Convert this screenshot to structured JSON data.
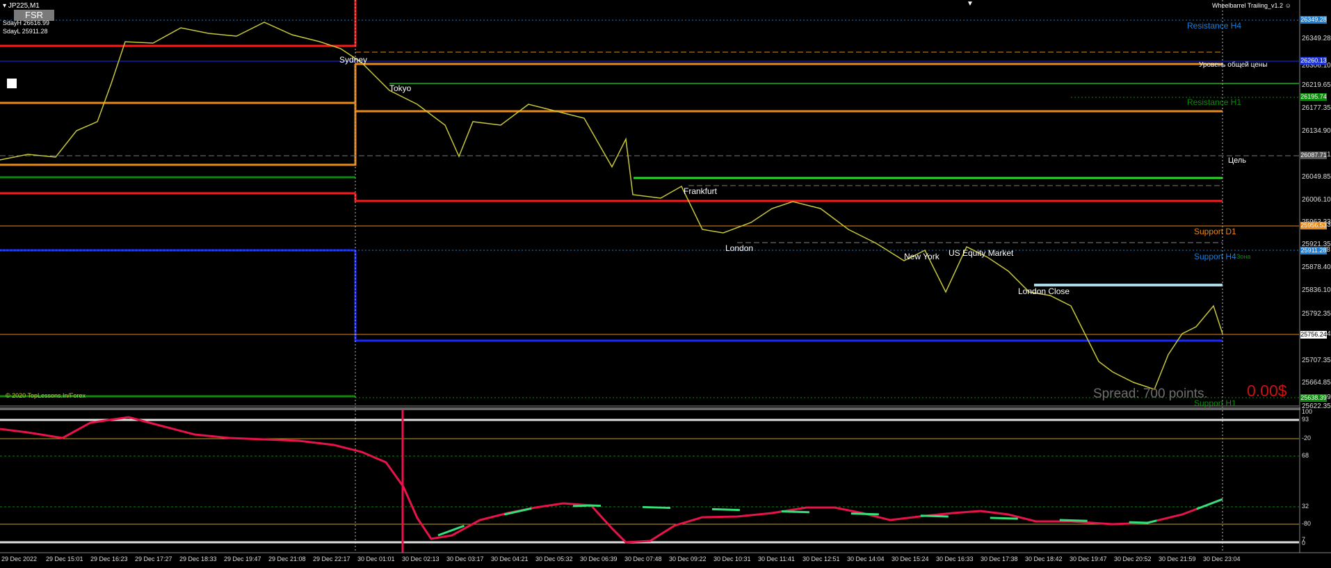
{
  "header": {
    "symbol": "JP225,M1",
    "sdayh": "SdayH 26616.99",
    "sdayl": "SdayL 25911.28",
    "fsr_button": "FSR",
    "expert_name": "Wheelbarrel Trailing_v1.2",
    "copyright": "© 2020 TopLessons.In/Forex"
  },
  "sessions": [
    "Sydney",
    "Tokyo",
    "Frankfurt",
    "London",
    "New York",
    "US Equity Market",
    "London Close"
  ],
  "level_labels": {
    "resistance_h4": "Resistance H4",
    "price_level_ru": "Уровень общей цены",
    "resistance_h1": "Resistance H1",
    "target_ru": "Цель",
    "support_d1": "Support D1",
    "support_h4": "Support H4",
    "support_h1": "Support H1",
    "zone_ru": "Зона"
  },
  "spread": "Spread: 700 points.",
  "profit": "0.00$",
  "price_axis": [
    "26349.28",
    "26306.10",
    "26219.65",
    "26177.35",
    "26134.90",
    "26087.71",
    "26049.85",
    "26006.10",
    "25963.33",
    "25956.53",
    "25921.35",
    "25911.28",
    "25878.40",
    "25836.10",
    "25792.35",
    "25756.24",
    "25707.35",
    "25664.85",
    "25638.39",
    "25622.35"
  ],
  "price_tags": [
    {
      "text": "26349.28",
      "color": "#1e7fd6"
    },
    {
      "text": "26260.13",
      "color": "#1e35d6"
    },
    {
      "text": "26195.74",
      "color": "#0c8a0c"
    },
    {
      "text": "26087.71",
      "color": "#555555"
    },
    {
      "text": "25956.53",
      "color": "#e8891a"
    },
    {
      "text": "25911.28",
      "color": "#1e7fd6"
    },
    {
      "text": "25756.24",
      "color": "#ffffff"
    },
    {
      "text": "25638.39",
      "color": "#0c8a0c"
    }
  ],
  "indicator_axis": [
    "100",
    "93",
    "-20",
    "68",
    "32",
    "-80",
    "7",
    "0"
  ],
  "time_axis": [
    "29 Dec 2022",
    "29 Dec 15:01",
    "29 Dec 16:23",
    "29 Dec 17:27",
    "29 Dec 18:33",
    "29 Dec 19:47",
    "29 Dec 21:08",
    "29 Dec 22:17",
    "30 Dec 01:01",
    "30 Dec 02:13",
    "30 Dec 03:17",
    "30 Dec 04:21",
    "30 Dec 05:32",
    "30 Dec 06:39",
    "30 Dec 07:48",
    "30 Dec 09:22",
    "30 Dec 10:31",
    "30 Dec 11:41",
    "30 Dec 12:51",
    "30 Dec 14:04",
    "30 Dec 15:24",
    "30 Dec 16:33",
    "30 Dec 17:38",
    "30 Dec 18:42",
    "30 Dec 19:47",
    "30 Dec 20:52",
    "30 Dec 21:59",
    "30 Dec 23:04"
  ],
  "colors": {
    "background": "#000000",
    "candles": "#c8c83a",
    "resistance": "#1e7fd6",
    "support_d1": "#e8891a",
    "support_h1": "#0c8a0c",
    "red_level": "#ff1a1a",
    "blue_level": "#1a2aff",
    "green_level": "#22dd22",
    "ind_up": "#33e07a",
    "ind_down": "#e8134a"
  }
}
